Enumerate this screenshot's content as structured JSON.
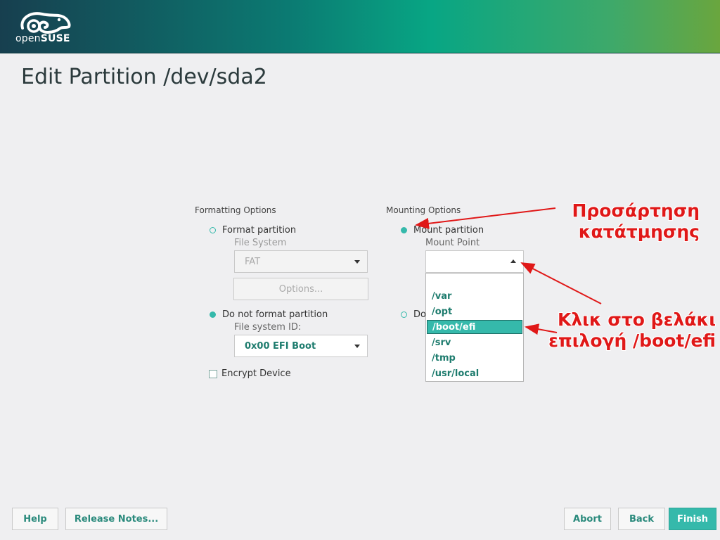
{
  "header": {
    "logo_text_regular": "open",
    "logo_text_bold": "SUSE",
    "brand_color": "#35b9ab"
  },
  "page": {
    "title": "Edit Partition /dev/sda2"
  },
  "formatting": {
    "group_label": "Formatting Options",
    "format_partition_label": "Format partition",
    "file_system_label": "File System",
    "file_system_value": "FAT",
    "options_button": "Options...",
    "do_not_format_label": "Do not format partition",
    "file_system_id_label": "File system ID:",
    "file_system_id_value": "0x00 EFI Boot",
    "encrypt_label": "Encrypt Device",
    "selected": "do_not_format"
  },
  "mounting": {
    "group_label": "Mounting Options",
    "mount_partition_label": "Mount partition",
    "mount_point_label": "Mount Point",
    "mount_point_value": "",
    "do_not_mount_label": "Do",
    "selected": "mount",
    "dropdown_items": [
      "/var",
      "/opt",
      "/boot/efi",
      "/srv",
      "/tmp",
      "/usr/local"
    ],
    "dropdown_selected": "/boot/efi"
  },
  "annotations": {
    "mount_line1": "Προσάρτηση",
    "mount_line2": "κατάτμησης",
    "click_line1": "Κλικ στο βελάκι",
    "click_line2": "επιλογή /boot/efi",
    "color": "#e01818"
  },
  "footer": {
    "help": "Help",
    "release_notes": "Release Notes...",
    "abort": "Abort",
    "back": "Back",
    "finish": "Finish"
  }
}
